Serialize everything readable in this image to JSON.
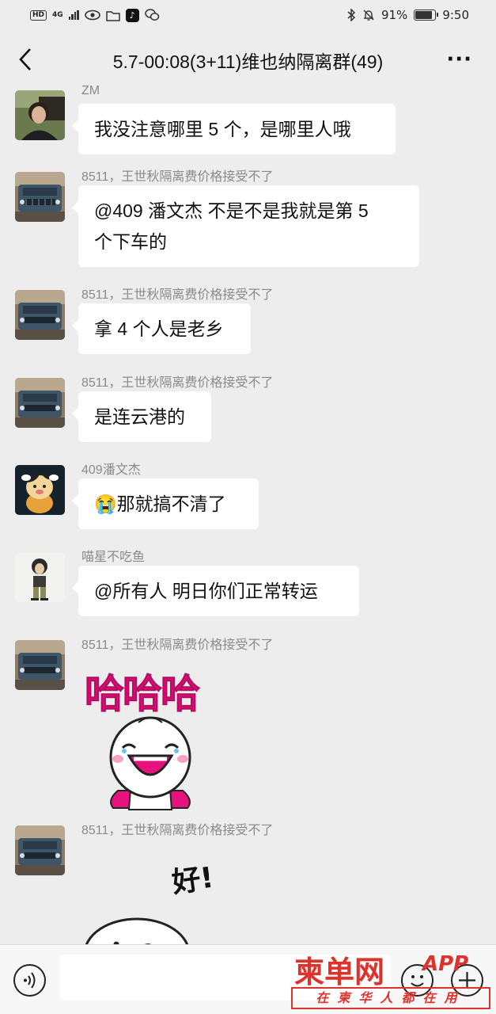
{
  "status_bar": {
    "hd": "HD",
    "network": "4G",
    "battery_percent": "91%",
    "battery_level": 0.91,
    "time": "9:50"
  },
  "header": {
    "back_icon": "chevron-left-icon",
    "title": "5.7-00:08(3+11)维也纳隔离群(49)",
    "more_label": "···"
  },
  "messages": [
    {
      "sender": "ZM",
      "text": "我没注意哪里 5 个，是哪里人哦",
      "avatar": "person-photo"
    },
    {
      "sender": "8511，王世秋隔离费价格接受不了",
      "text_lines": [
        "@409 潘文杰  不是不是我就是第 5",
        "个下车的"
      ],
      "avatar": "car-photo"
    },
    {
      "sender": "8511，王世秋隔离费价格接受不了",
      "text": "拿 4 个人是老乡",
      "avatar": "car-photo"
    },
    {
      "sender": "8511，王世秋隔离费价格接受不了",
      "text": "是连云港的",
      "avatar": "car-photo"
    },
    {
      "sender": "409潘文杰",
      "emoji": "😭",
      "text": "那就搞不清了",
      "avatar": "cartoon-cow"
    },
    {
      "sender": "喵星不吃鱼",
      "text": "@所有人 明日你们正常转运",
      "avatar": "cartoon-person"
    },
    {
      "sender": "8511，王世秋隔离费价格接受不了",
      "sticker_text": "哈哈哈",
      "avatar": "car-photo"
    },
    {
      "sender": "8511，王世秋隔离费价格接受不了",
      "sticker_text": "好!",
      "avatar": "car-photo"
    }
  ],
  "input_bar": {
    "voice_icon": "voice-icon",
    "emoji_icon": "emoji-icon",
    "plus_icon": "plus-icon"
  },
  "watermark": {
    "main": "柬单网",
    "app": "APP",
    "sub": "在柬华人都在用"
  },
  "colors": {
    "background": "#ededed",
    "bubble": "#ffffff",
    "sticker_pink": "#e8127f",
    "watermark_red": "#e0322c"
  }
}
